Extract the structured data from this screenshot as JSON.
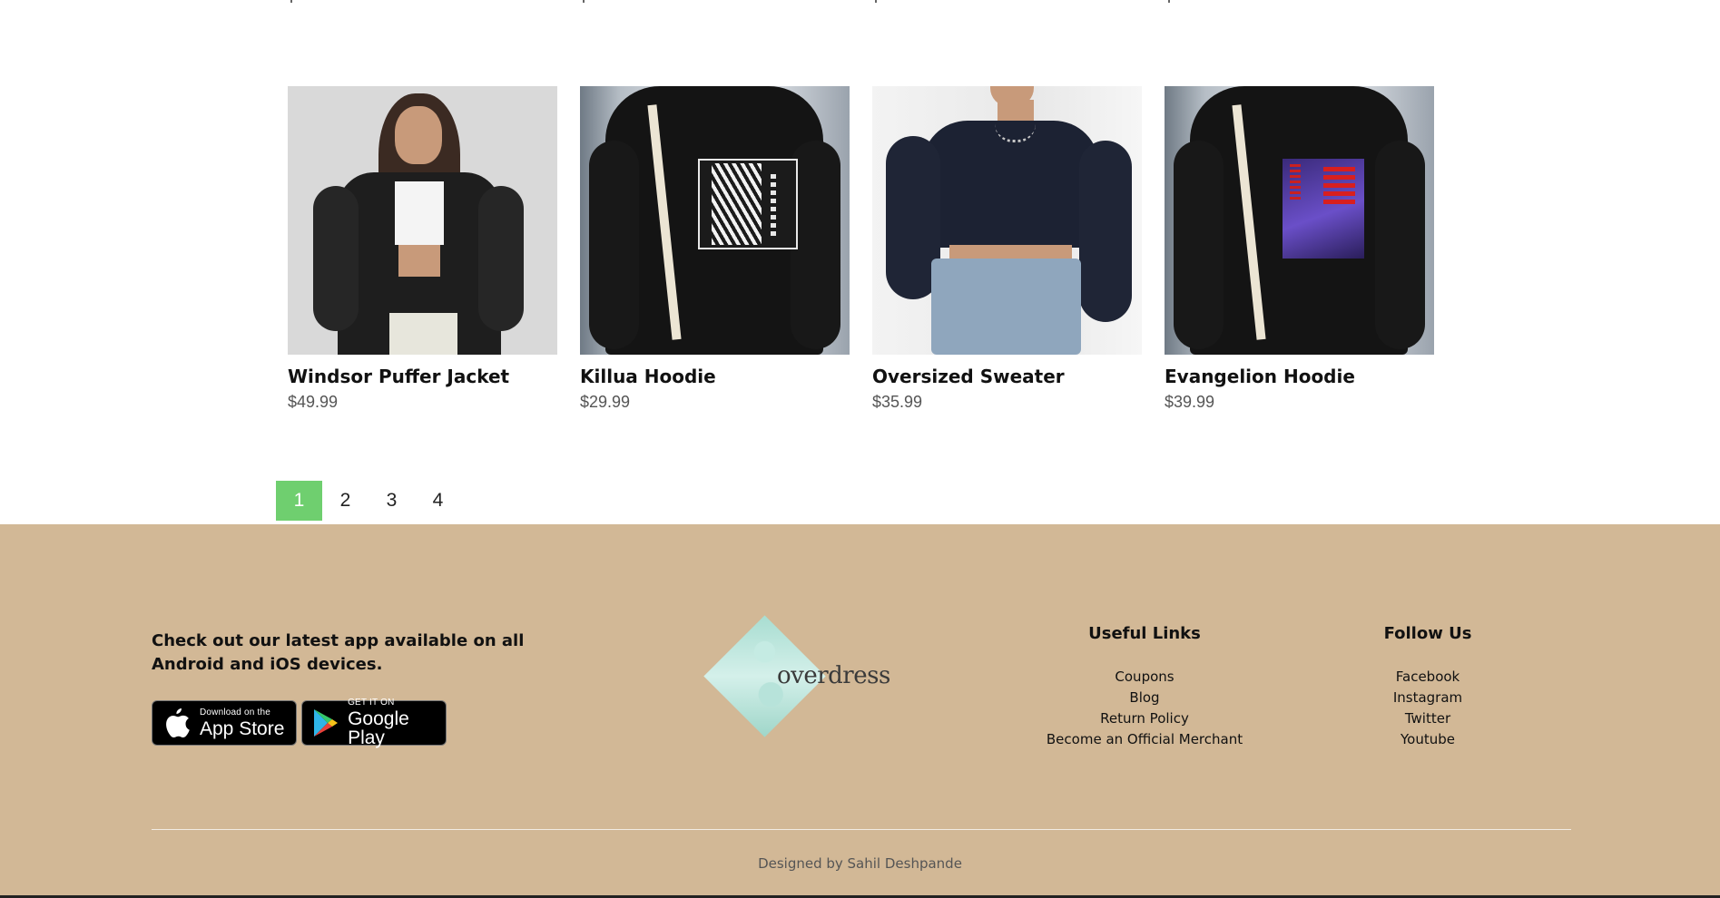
{
  "products": [
    {
      "name": "Windsor Puffer Jacket",
      "price": "$49.99",
      "image": "black-puffer-jacket-model"
    },
    {
      "name": "Killua Hoodie",
      "price": "$29.99",
      "image": "black-hoodie-anime-print"
    },
    {
      "name": "Oversized Sweater",
      "price": "$35.99",
      "image": "navy-cropped-sweater-model"
    },
    {
      "name": "Evangelion Hoodie",
      "price": "$39.99",
      "image": "black-hoodie-evangelion-print"
    }
  ],
  "pagination": {
    "pages": [
      "1",
      "2",
      "3",
      "4"
    ],
    "current": "1",
    "active_color": "#6fcf6f"
  },
  "footer": {
    "background": "#d2b896",
    "app_text": "Check out our latest app available on all Android and iOS devices.",
    "app_store": {
      "small": "Download on the",
      "big": "App Store"
    },
    "google_play": {
      "small": "GET IT ON",
      "big": "Google Play"
    },
    "logo_text": "overdress",
    "useful_links": {
      "title": "Useful Links",
      "items": [
        "Coupons",
        "Blog",
        "Return Policy",
        "Become an Official Merchant"
      ]
    },
    "follow_us": {
      "title": "Follow Us",
      "items": [
        "Facebook",
        "Instagram",
        "Twitter",
        "Youtube"
      ]
    },
    "credit": "Designed by Sahil Deshpande"
  }
}
